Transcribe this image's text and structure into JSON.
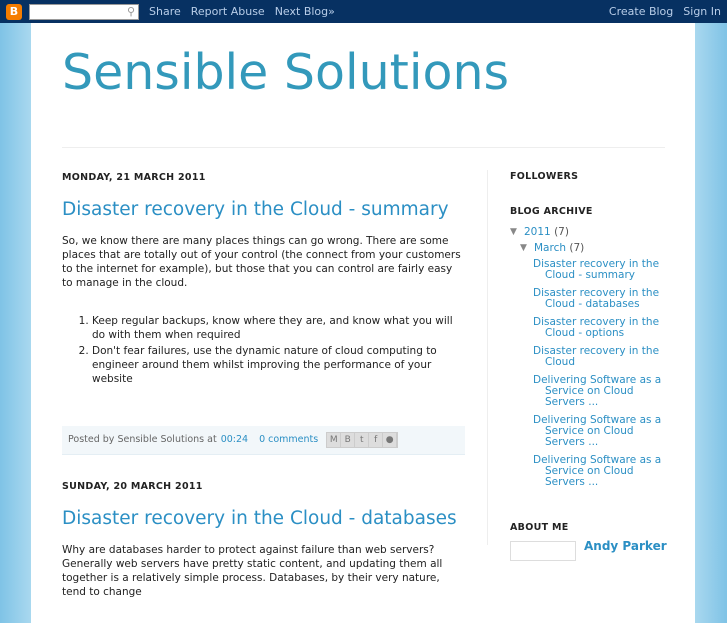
{
  "navbar": {
    "logo": "B",
    "search_icon": "search-icon",
    "share": "Share",
    "report": "Report Abuse",
    "next": "Next Blog»",
    "create": "Create Blog",
    "signin": "Sign In"
  },
  "blog_title": "Sensible Solutions",
  "posts": [
    {
      "date": "MONDAY, 21 MARCH 2011",
      "title": "Disaster recovery in the Cloud - summary",
      "para": "So, we know there are many places things can go wrong.  There are some places that are totally out of your control (the connect from your customers to the internet for example), but those that you can control are fairly easy to manage in the cloud.",
      "list": [
        "Keep regular backups, know where they are, and know what you will do with them when required",
        "Don't fear failures, use the dynamic nature of cloud computing to engineer around them whilst improving the performance of your website"
      ],
      "posted_by": "Posted by Sensible Solutions at",
      "time": "00:24",
      "comments": "0 comments"
    },
    {
      "date": "SUNDAY, 20 MARCH 2011",
      "title": "Disaster recovery in the Cloud - databases",
      "para": "Why are databases harder to protect against failure than web servers?  Generally web servers have pretty static content, and updating them all together is a relatively simple process.  Databases, by their very nature, tend to change"
    }
  ],
  "sidebar": {
    "followers": "FOLLOWERS",
    "archive": "BLOG ARCHIVE",
    "year": "2011",
    "year_count": "(7)",
    "month": "March",
    "month_count": "(7)",
    "archive_posts": [
      "Disaster recovery in the Cloud - summary",
      "Disaster recovery in the Cloud - databases",
      "Disaster recovery in the Cloud - options",
      "Disaster recovery in the Cloud",
      "Delivering Software as a Service on Cloud Servers ...",
      "Delivering Software as a Service on Cloud Servers ...",
      "Delivering Software as a Service on Cloud Servers ..."
    ],
    "about": "ABOUT ME",
    "author": "Andy Parker"
  }
}
